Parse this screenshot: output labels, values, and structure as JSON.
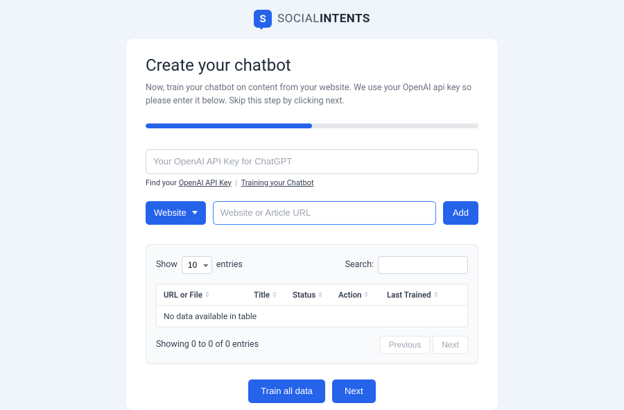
{
  "brand": {
    "icon_letter": "S",
    "name_light": "SOCIAL",
    "name_bold": "INTENTS"
  },
  "header": {
    "title": "Create your chatbot",
    "subtitle": "Now, train your chatbot on content from your website. We use your OpenAI api key so please enter it below. Skip this step by clicking next."
  },
  "progress": {
    "percent": 50
  },
  "api": {
    "placeholder": "Your OpenAI API Key for ChatGPT",
    "find_prefix": "Find your ",
    "link1": "OpenAI API Key",
    "sep": "|",
    "link2": "Training your Chatbot"
  },
  "source": {
    "dropdown_label": "Website",
    "url_placeholder": "Website or Article URL",
    "add_label": "Add"
  },
  "table": {
    "show_label": "Show",
    "entries_label": "entries",
    "entries_value": "10",
    "search_label": "Search:",
    "columns": {
      "url": "URL or File",
      "title": "Title",
      "status": "Status",
      "action": "Action",
      "last_trained": "Last Trained"
    },
    "empty": "No data available in table",
    "info": "Showing 0 to 0 of 0 entries",
    "prev": "Previous",
    "next": "Next"
  },
  "actions": {
    "train_all": "Train all data",
    "next": "Next"
  }
}
